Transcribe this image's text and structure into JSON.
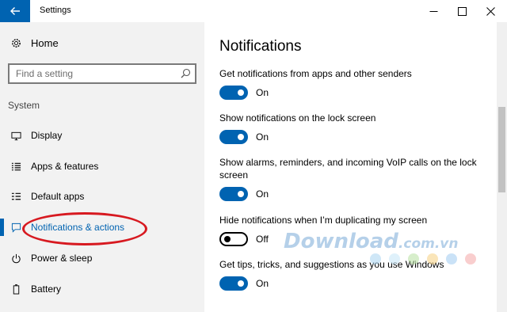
{
  "window": {
    "title": "Settings"
  },
  "sidebar": {
    "home_label": "Home",
    "search_placeholder": "Find a setting",
    "section_title": "System",
    "items": [
      {
        "label": "Display",
        "icon": "monitor-icon"
      },
      {
        "label": "Apps & features",
        "icon": "list-icon"
      },
      {
        "label": "Default apps",
        "icon": "default-apps-icon"
      },
      {
        "label": "Notifications & actions",
        "icon": "notification-icon",
        "selected": true
      },
      {
        "label": "Power & sleep",
        "icon": "power-icon"
      },
      {
        "label": "Battery",
        "icon": "battery-icon"
      }
    ]
  },
  "main": {
    "title": "Notifications",
    "settings": [
      {
        "label": "Get notifications from apps and other senders",
        "state": "On"
      },
      {
        "label": "Show notifications on the lock screen",
        "state": "On"
      },
      {
        "label": "Show alarms, reminders, and incoming VoIP calls on the lock screen",
        "state": "On"
      },
      {
        "label": "Hide notifications when I’m duplicating my screen",
        "state": "Off"
      },
      {
        "label": "Get tips, tricks, and suggestions as you use Windows",
        "state": "On"
      }
    ]
  },
  "watermark": {
    "brand": "Download",
    "suffix": ".com.vn",
    "dot_colors": [
      "#a8d4f0",
      "#c5e5f7",
      "#b6e0a0",
      "#f5d080",
      "#9fcaf0",
      "#f4a6a6"
    ]
  },
  "colors": {
    "accent": "#0063b1",
    "highlight_ellipse": "#d71920"
  }
}
